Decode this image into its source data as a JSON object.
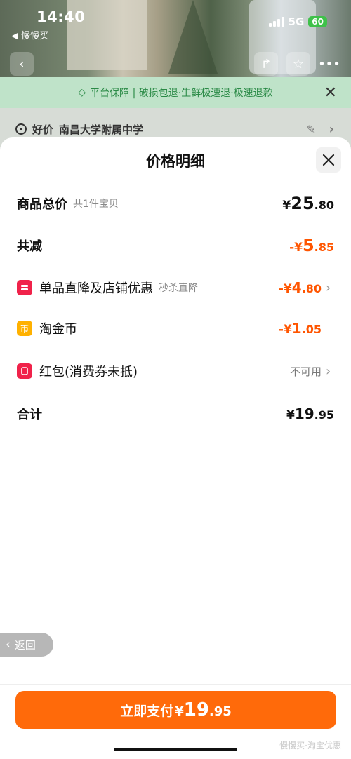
{
  "status_bar": {
    "time": "14:40",
    "back_app": "◀ 慢慢买",
    "network": "5G",
    "battery": "60"
  },
  "background": {
    "banner": "平台保障 | 破损包退·生鲜极速退·极速退款",
    "address_tag": "好价",
    "address": "南昌大学附属中学"
  },
  "sheet": {
    "title": "价格明细",
    "rows": {
      "total": {
        "label": "商品总价",
        "sub": "共1件宝贝",
        "sym": "¥",
        "int": "25",
        "dec": ".80"
      },
      "reduce": {
        "label": "共减",
        "sym": "-¥",
        "int": "5",
        "dec": ".85"
      },
      "promo": {
        "label": "单品直降及店铺优惠",
        "sub": "秒杀直降",
        "sym": "-¥",
        "int": "4",
        "dec": ".80"
      },
      "coin": {
        "label": "淘金币",
        "sym": "-¥",
        "int": "1",
        "dec": ".05"
      },
      "redpacket": {
        "label": "红包(消费券未抵)",
        "status": "不可用"
      },
      "sum": {
        "label": "合计",
        "sym": "¥",
        "int": "19",
        "dec": ".95"
      }
    }
  },
  "back_button": "返回",
  "pay_button": {
    "label": "立即支付",
    "sym": "¥",
    "int": "19",
    "dec": ".95"
  },
  "watermark": "慢慢买·淘宝优惠",
  "colors": {
    "accent": "#ff6a0a",
    "discount": "#ff5500",
    "red_icon": "#f0224a",
    "coin_icon": "#ffb100"
  }
}
